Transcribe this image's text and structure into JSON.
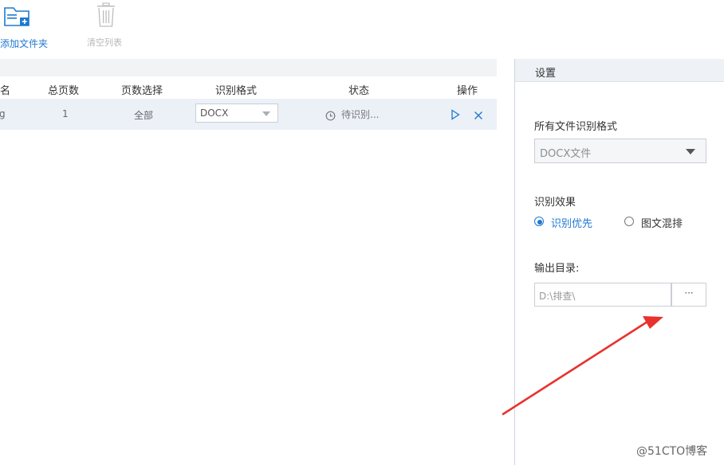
{
  "toolbar": {
    "add_folder_label": "添加文件夹",
    "clear_list_label": "清空列表"
  },
  "file_list": {
    "columns": [
      "名",
      "总页数",
      "页数选择",
      "识别格式",
      "状态",
      "操作"
    ],
    "rows": [
      {
        "name": "g",
        "total_pages": "1",
        "page_selection": "全部",
        "format": "DOCX",
        "status": "待识别..."
      }
    ]
  },
  "settings": {
    "title": "设置",
    "all_format_label": "所有文件识别格式",
    "all_format_value": "DOCX文件",
    "effect_label": "识别效果",
    "effect_options": [
      "识别优先",
      "图文混排"
    ],
    "effect_selected": "识别优先",
    "output_dir_label": "输出目录:",
    "output_dir_value": "D:\\排查\\",
    "browse_label": "···"
  },
  "watermark": "@51CTO博客",
  "colors": {
    "accent": "#1f78d1",
    "annotation_arrow": "#e8322e",
    "row_highlight": "#ecf1f8"
  }
}
